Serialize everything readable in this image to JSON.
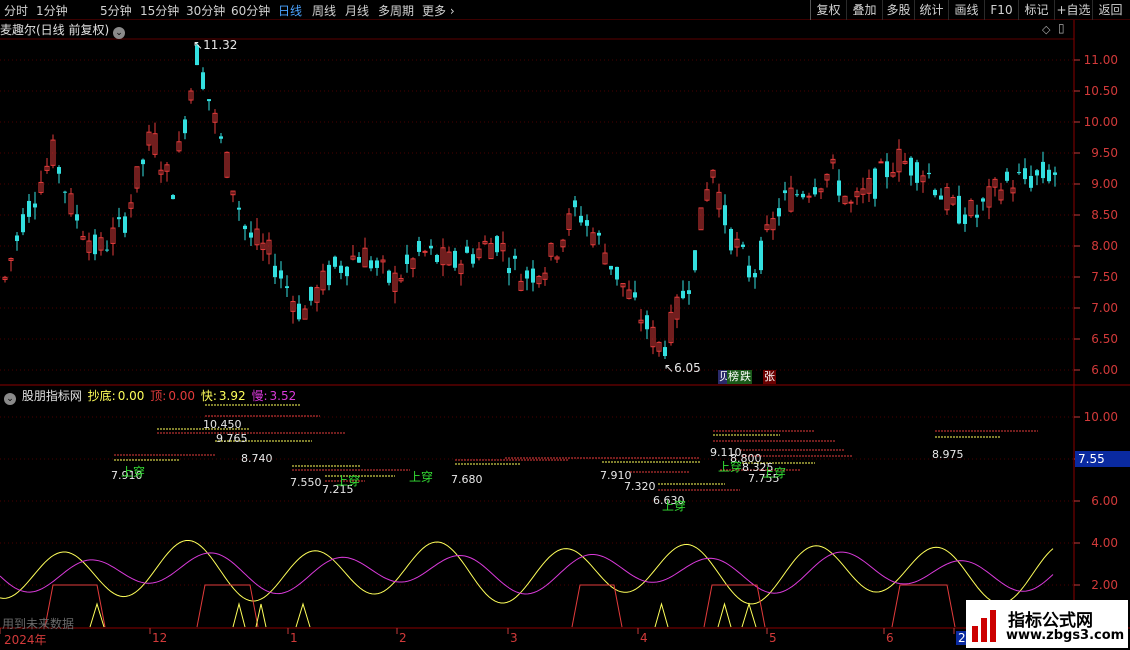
{
  "toolbar": {
    "periods": [
      "分时",
      "1分钟",
      "5分钟",
      "15分钟",
      "30分钟",
      "60分钟",
      "日线",
      "周线",
      "月线",
      "多周期",
      "更多"
    ],
    "active_period": "日线",
    "buttons": [
      "复权",
      "叠加",
      "多股",
      "统计",
      "画线",
      "F10",
      "标记",
      "+自选",
      "返回"
    ]
  },
  "chart_title": {
    "stock": "麦趣尔(日线 前复权)"
  },
  "price_panel": {
    "y_ticks": [
      "11.00",
      "10.50",
      "10.00",
      "9.50",
      "9.00",
      "8.50",
      "8.00",
      "7.50",
      "7.00",
      "6.50",
      "6.00"
    ],
    "high_label": "11.32",
    "low_label": "6.05",
    "badges": [
      "贝",
      "榜",
      "跌",
      "张"
    ]
  },
  "indicator": {
    "name": "股朋指标网",
    "chaodi_label": "抄底:",
    "chaodi_value": "0.00",
    "ding_label": "顶:",
    "ding_value": "0.00",
    "kuai_label": "快:",
    "kuai_value": "3.92",
    "man_label": "慢:",
    "man_value": "3.52",
    "y_ticks": [
      "10.00",
      "8.00",
      "6.00",
      "4.00",
      "2.00"
    ],
    "current_value": "7.55",
    "level_labels": [
      "10.450",
      "9.765",
      "8.740",
      "7.910",
      "7.550",
      "7.215",
      "7.680",
      "7.910",
      "7.320",
      "6.630",
      "9.110",
      "8.800",
      "8.325",
      "7.755",
      "8.975"
    ],
    "signal_labels": [
      "上穿",
      "上穿",
      "上穿",
      "上穿",
      "上穿",
      "上穿"
    ],
    "future_note": "用到未来数据"
  },
  "x_axis": {
    "labels": [
      "2024年",
      "12",
      "1",
      "2",
      "3",
      "4",
      "5",
      "6",
      "202"
    ]
  },
  "watermark": {
    "line1": "指标公式网",
    "line2": "www.zbgs3.com"
  },
  "colors": {
    "up": "#e23b3b",
    "down": "#33e0e0",
    "kuai": "#ffff5a",
    "man": "#d93ad9",
    "chaodi": "#ffff5a",
    "ding": "#e23b3b",
    "grid": "#5a0000",
    "active": "#4aa3ff"
  }
}
